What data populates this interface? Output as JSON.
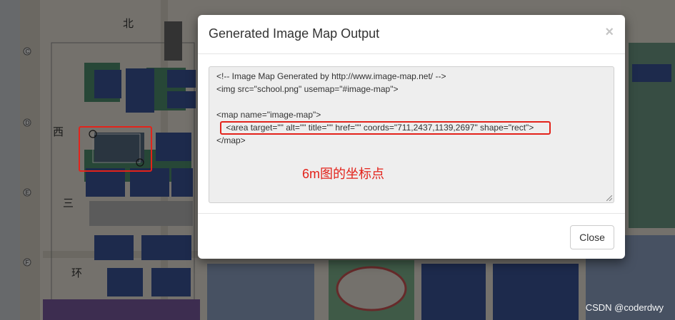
{
  "modal": {
    "title": "Generated Image Map Output",
    "close_glyph": "×",
    "close_button_label": "Close",
    "code_lines": [
      "<!-- Image Map Generated by http://www.image-map.net/ -->",
      "<img src=\"school.png\" usemap=\"#image-map\">",
      "",
      "<map name=\"image-map\">",
      "    <area target=\"\" alt=\"\" title=\"\" href=\"\" coords=\"711,2437,1139,2697\" shape=\"rect\">",
      "</map>"
    ]
  },
  "annotation": {
    "note": "6m图的坐标点",
    "color": "#e3231b"
  },
  "watermark": "CSDN @coderdwy",
  "map": {
    "grid_letters": [
      "C",
      "D",
      "E",
      "F"
    ],
    "labels": {
      "north": "北",
      "west": "西",
      "three": "三",
      "ring": "环"
    }
  },
  "colors": {
    "building": "#3b5599",
    "green": "#4f8f6e",
    "road": "#d9d4cc"
  }
}
